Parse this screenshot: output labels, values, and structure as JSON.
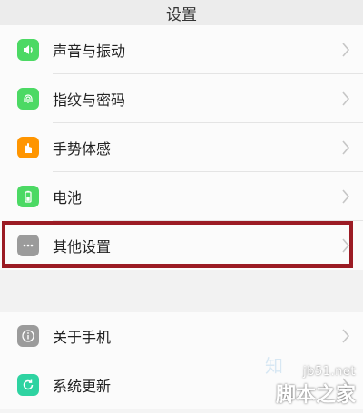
{
  "header": {
    "title": "设置"
  },
  "main_items": [
    {
      "label": "声音与振动",
      "icon": "speaker-icon",
      "color": "#4cd964"
    },
    {
      "label": "指纹与密码",
      "icon": "fingerprint-icon",
      "color": "#4cd964"
    },
    {
      "label": "手势体感",
      "icon": "hand-gesture-icon",
      "color": "#ff9500"
    },
    {
      "label": "电池",
      "icon": "battery-icon",
      "color": "#4cd964"
    },
    {
      "label": "其他设置",
      "icon": "more-dots-icon",
      "color": "#9b9b9b"
    }
  ],
  "secondary_items": [
    {
      "label": "关于手机",
      "icon": "info-icon",
      "color": "#9b9b9b"
    },
    {
      "label": "系统更新",
      "icon": "update-icon",
      "color": "#2ed3a1"
    }
  ],
  "highlight": {
    "color": "#9b1b24",
    "target": "其他设置"
  },
  "watermark": {
    "url": "jb51.net",
    "name": "脚本之家"
  }
}
